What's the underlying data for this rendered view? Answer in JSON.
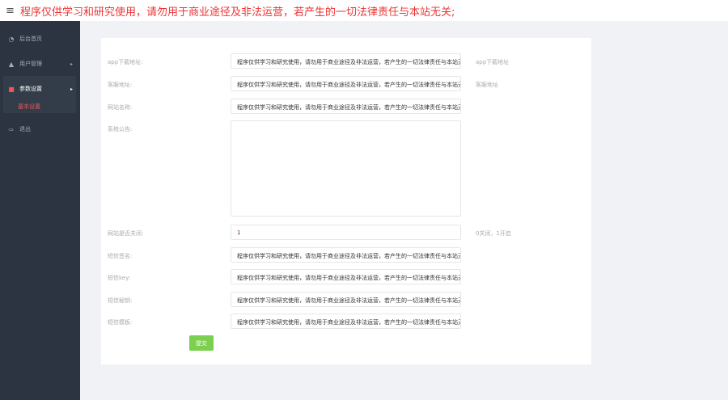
{
  "header": {
    "menu_icon": "hamburger-icon",
    "notice": "程序仅供学习和研究使用，请勿用于商业途径及非法运营，若产生的一切法律责任与本站无关;"
  },
  "sidebar": {
    "items": [
      {
        "label": "后台首页",
        "icon": "dashboard-icon"
      },
      {
        "label": "用户管理",
        "icon": "user-icon"
      },
      {
        "label": "参数设置",
        "icon": "file-icon"
      },
      {
        "label": "退出",
        "icon": "logout-icon"
      }
    ],
    "sub_item": "基本设置"
  },
  "form": {
    "fields": [
      {
        "label": "app下载地址:",
        "value": "程序仅供学习和研究使用，请勿用于商业途径及非法运营，若产生的一切法律责任与本站无关;",
        "hint": "app下载地址"
      },
      {
        "label": "客服地址:",
        "value": "程序仅供学习和研究使用，请勿用于商业途径及非法运营，若产生的一切法律责任与本站无关;",
        "hint": "客服地址"
      },
      {
        "label": "网站名称:",
        "value": "程序仅供学习和研究使用，请勿用于商业途径及非法运营，若产生的一切法律责任与本站无关;"
      },
      {
        "label": "系统公告:",
        "value": ""
      },
      {
        "label": "网站是否关闭:",
        "value": "1",
        "hint": "0关闭，1开启"
      },
      {
        "label": "短信签名:",
        "value": "程序仅供学习和研究使用，请勿用于商业途径及非法运营，若产生的一切法律责任与本站无关;"
      },
      {
        "label": "短信key:",
        "value": "程序仅供学习和研究使用，请勿用于商业途径及非法运营，若产生的一切法律责任与本站无关;"
      },
      {
        "label": "短信秘钥:",
        "value": "程序仅供学习和研究使用，请勿用于商业途径及非法运营，若产生的一切法律责任与本站无关;"
      },
      {
        "label": "短信模板:",
        "value": "程序仅供学习和研究使用，请勿用于商业途径及非法运营，若产生的一切法律责任与本站无关;"
      }
    ],
    "submit": "提交"
  }
}
